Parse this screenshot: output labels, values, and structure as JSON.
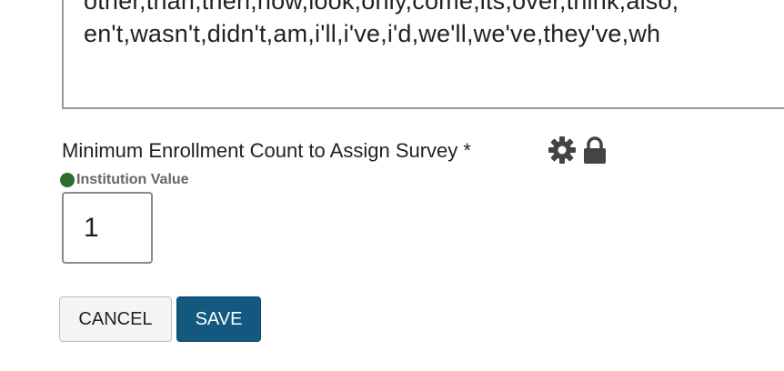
{
  "textarea": {
    "line1": "other,than,then,now,look,only,come,its,over,think,also,",
    "line2": "en't,wasn't,didn't,am,i'll,i've,i'd,we'll,we've,they've,wh"
  },
  "field": {
    "label": "Minimum Enrollment Count to Assign Survey *",
    "icons": [
      "gear-icon",
      "lock-icon"
    ],
    "source_label": "Institution Value",
    "source_color": "#2e6b2f",
    "value": "1"
  },
  "buttons": {
    "cancel_label": "CANCEL",
    "save_label": "SAVE",
    "save_color": "#13587e"
  }
}
